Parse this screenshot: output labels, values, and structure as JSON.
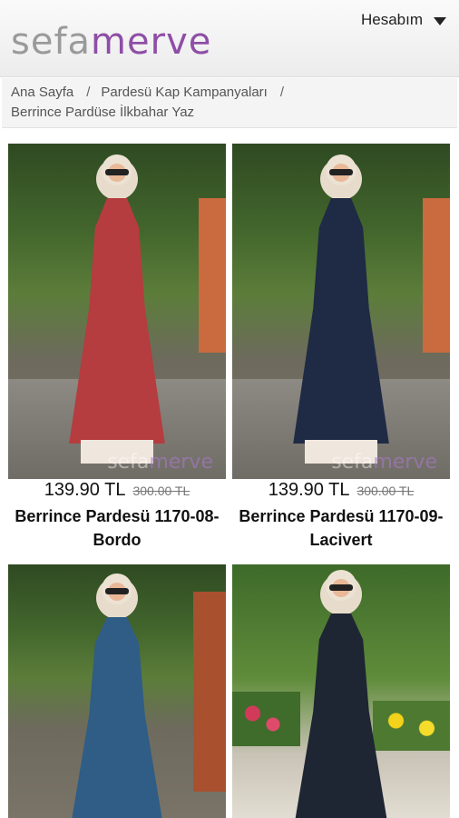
{
  "header": {
    "logo_part1": "sefa",
    "logo_part2": "merve",
    "account_label": "Hesabım"
  },
  "breadcrumb": {
    "items": [
      "Ana Sayfa",
      "Pardesü Kap Kampanyaları",
      "Berrince Pardüse İlkbahar Yaz"
    ],
    "separator": "/"
  },
  "products": [
    {
      "name": "Berrince Pardesü 1170-08-Bordo",
      "price": "139.90 TL",
      "old_price": "300.00 TL",
      "coat_color": "#b53c3f",
      "watermark": "sefamerve"
    },
    {
      "name": "Berrince Pardesü 1170-09-Lacivert",
      "price": "139.90 TL",
      "old_price": "300.00 TL",
      "coat_color": "#1f2a45",
      "watermark": "sefamerve"
    },
    {
      "name": "",
      "price": "",
      "old_price": "",
      "coat_color": "#2f5d86",
      "watermark": ""
    },
    {
      "name": "",
      "price": "",
      "old_price": "",
      "coat_color": "#1e2533",
      "watermark": ""
    }
  ]
}
